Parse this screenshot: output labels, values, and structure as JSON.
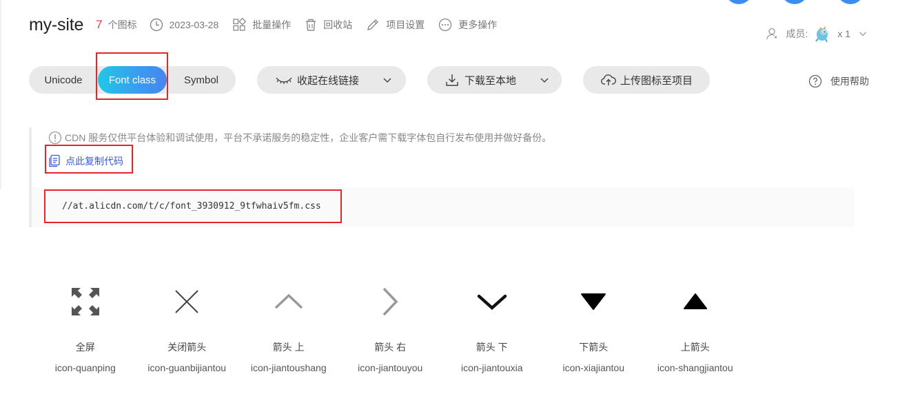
{
  "header": {
    "site_name": "my-site",
    "icon_count": "7",
    "icon_count_unit": "个图标",
    "date": "2023-03-28",
    "batch_label": "批量操作",
    "trash_label": "回收站",
    "settings_label": "项目设置",
    "more_label": "更多操作"
  },
  "members": {
    "label": "成员:",
    "count": "x 1"
  },
  "tabs": {
    "unicode": "Unicode",
    "font_class": "Font class",
    "symbol": "Symbol",
    "active": "Font class"
  },
  "toolbar": {
    "collapse_link": "收起在线链接",
    "download": "下载至本地",
    "upload": "上传图标至项目",
    "help": "使用帮助"
  },
  "cdn": {
    "notice": "CDN 服务仅供平台体验和调试使用，平台不承诺服务的稳定性，企业客户需下载字体包自行发布使用并做好备份。",
    "copy_code": "点此复制代码",
    "css_url": "//at.alicdn.com/t/c/font_3930912_9tfwhaiv5fm.css"
  },
  "icons": [
    {
      "name": "全屏",
      "class": "icon-quanping",
      "glyph": "fullscreen-expand-icon"
    },
    {
      "name": "关闭箭头",
      "class": "icon-guanbijiantou",
      "glyph": "close-x-icon"
    },
    {
      "name": "箭头 上",
      "class": "icon-jiantoushang",
      "glyph": "chevron-up-icon"
    },
    {
      "name": "箭头 右",
      "class": "icon-jiantouyou",
      "glyph": "chevron-right-icon"
    },
    {
      "name": "箭头 下",
      "class": "icon-jiantouxia",
      "glyph": "chevron-down-icon"
    },
    {
      "name": "下箭头",
      "class": "icon-xiajiantou",
      "glyph": "triangle-down-icon"
    },
    {
      "name": "上箭头",
      "class": "icon-shangjiantou",
      "glyph": "triangle-up-icon"
    }
  ],
  "colors": {
    "accent_red": "#e3373f",
    "link_blue": "#3659e6",
    "tab_gradient_start": "#1fc8e6",
    "tab_gradient_end": "#4785ee",
    "highlight_border": "#e2242b"
  }
}
